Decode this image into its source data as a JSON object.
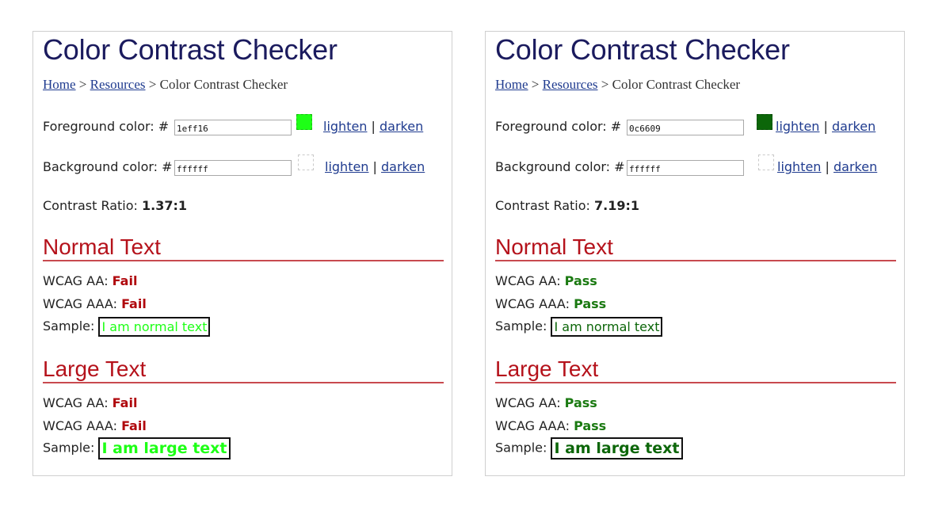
{
  "panels": [
    {
      "title": "Color Contrast Checker",
      "breadcrumb": {
        "home": "Home",
        "sep1": " > ",
        "resources": "Resources",
        "sep2": " > ",
        "current": "Color Contrast Checker"
      },
      "foreground": {
        "label": "Foreground color: #",
        "value": "1eff16",
        "color": "#1eff16",
        "lighten": "lighten",
        "sep": " | ",
        "darken": "darken"
      },
      "background": {
        "label": "Background color: #",
        "value": "ffffff",
        "color": "#ffffff",
        "lighten": "lighten",
        "sep": " | ",
        "darken": "darken"
      },
      "contrast": {
        "label": "Contrast Ratio: ",
        "value": "1.37:1"
      },
      "normal": {
        "heading": "Normal Text",
        "aa_label": "WCAG AA: ",
        "aa_value": "Fail",
        "aa_status": "fail",
        "aaa_label": "WCAG AAA: ",
        "aaa_value": "Fail",
        "aaa_status": "fail",
        "sample_label": "Sample: ",
        "sample_text": "I am normal text"
      },
      "large": {
        "heading": "Large Text",
        "aa_label": "WCAG AA: ",
        "aa_value": "Fail",
        "aa_status": "fail",
        "aaa_label": "WCAG AAA: ",
        "aaa_value": "Fail",
        "aaa_status": "fail",
        "sample_label": "Sample: ",
        "sample_text": "I am large text"
      }
    },
    {
      "title": "Color Contrast Checker",
      "breadcrumb": {
        "home": "Home",
        "sep1": " > ",
        "resources": "Resources",
        "sep2": " > ",
        "current": "Color Contrast Checker"
      },
      "foreground": {
        "label": "Foreground color: #",
        "value": "0c6609",
        "color": "#0c6609",
        "lighten": "lighten",
        "sep": " | ",
        "darken": "darken"
      },
      "background": {
        "label": "Background color: #",
        "value": "ffffff",
        "color": "#ffffff",
        "lighten": "lighten",
        "sep": " | ",
        "darken": "darken"
      },
      "contrast": {
        "label": "Contrast Ratio: ",
        "value": "7.19:1"
      },
      "normal": {
        "heading": "Normal Text",
        "aa_label": "WCAG AA: ",
        "aa_value": "Pass",
        "aa_status": "pass",
        "aaa_label": "WCAG AAA: ",
        "aaa_value": "Pass",
        "aaa_status": "pass",
        "sample_label": "Sample: ",
        "sample_text": "I am normal text"
      },
      "large": {
        "heading": "Large Text",
        "aa_label": "WCAG AA: ",
        "aa_value": "Pass",
        "aa_status": "pass",
        "aaa_label": "WCAG AAA: ",
        "aaa_value": "Pass",
        "aaa_status": "pass",
        "sample_label": "Sample: ",
        "sample_text": "I am large text"
      }
    }
  ]
}
